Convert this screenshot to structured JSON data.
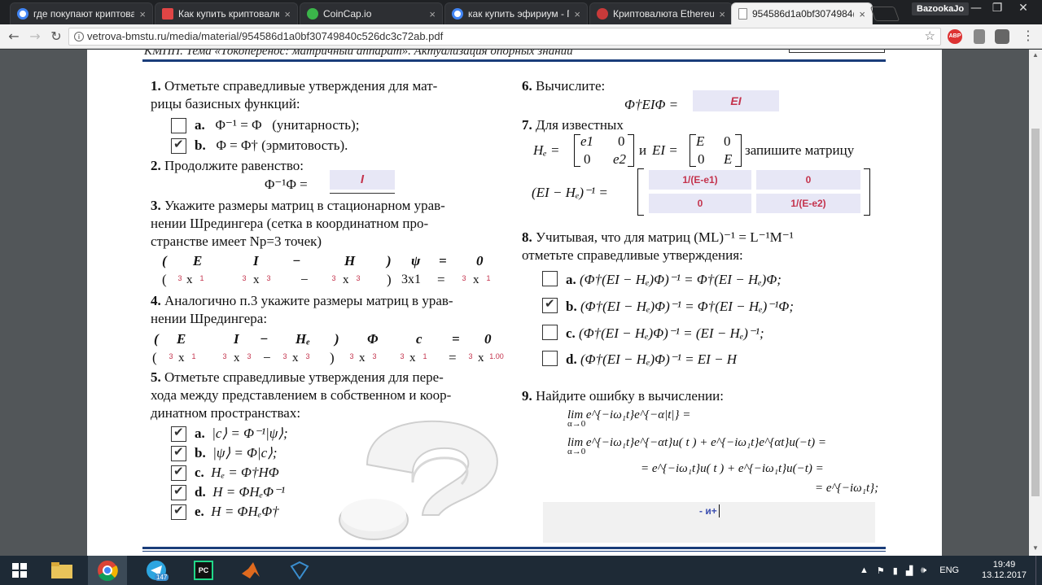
{
  "browser": {
    "tabs": [
      {
        "title": "где покупают криптова",
        "favicon": "google",
        "color": "#4285f4"
      },
      {
        "title": "Как купить криптовалю",
        "favicon": "d",
        "color": "#e04545"
      },
      {
        "title": "CoinCap.io",
        "favicon": "coincap",
        "color": "#3bb54a"
      },
      {
        "title": "как купить эфириум - Г",
        "favicon": "google",
        "color": "#4285f4"
      },
      {
        "title": "Криптовалюта Ethereu",
        "favicon": "eth",
        "color": "#c83a3a"
      },
      {
        "title": "954586d1a0bf3074984(",
        "favicon": "doc",
        "color": "#888888"
      }
    ],
    "profile": "BazookaJo",
    "url": "vetrova-bmstu.ru/media/material/954586d1a0bf30749840c526dc3c72ab.pdf",
    "ext_abp": "ABP"
  },
  "doc": {
    "header": "КМПП. Тема «Токоперенос: матричный аппарат». Актуализация опорных знаний",
    "q1": {
      "num": "1.",
      "text1": "Отметьте справедливые утверждения для мат-",
      "text2": "рицы базисных функций:",
      "a": {
        "label": "a.",
        "expr": "Φ⁻¹ = Φ",
        "note": "(унитарность);",
        "checked": false
      },
      "b": {
        "label": "b.",
        "expr": "Φ    = Φ†",
        "note": "(эрмитовость).",
        "checked": true
      }
    },
    "q2": {
      "num": "2.",
      "text": "Продолжите равенство:",
      "expr": "Φ⁻¹Φ =",
      "answer": "I"
    },
    "q3": {
      "num": "3.",
      "line1": "Укажите размеры матриц в стационарном урав-",
      "line2": "нении Шредингера (сетка в координатном про-",
      "line3": "странстве имеет Np=3 точек)",
      "eq": [
        "(",
        "E",
        "I",
        "−",
        "H",
        ")",
        "ψ",
        "=",
        "0"
      ],
      "sizes": [
        "3",
        "1",
        "3",
        "3",
        "3",
        "3",
        "3",
        "1"
      ],
      "x": "x",
      "minus": "−",
      "paren_close": ")",
      "fixed": "3x1",
      "eq_sign": "="
    },
    "q4": {
      "num": "4.",
      "line1": "Аналогично п.3 укажите размеры матриц в урав-",
      "line2": "нении Шредингера:",
      "eq": [
        "(",
        "E",
        "I",
        "−",
        "Hₑ",
        ")",
        "Φ",
        "c",
        "=",
        "0"
      ],
      "sizes": [
        "3",
        "1",
        "3",
        "3",
        "3",
        "3",
        "3",
        "3",
        "3",
        "1",
        "3",
        "1.00"
      ]
    },
    "q5": {
      "num": "5.",
      "line1": "Отметьте справедливые утверждения для пере-",
      "line2": "хода между представлением в собственном и коор-",
      "line3": "динатном пространствах:",
      "items": [
        {
          "label": "a.",
          "expr": "|c⟩ = Φ⁻¹|ψ⟩;",
          "checked": true
        },
        {
          "label": "b.",
          "expr": "|ψ⟩ = Φ|c⟩;",
          "checked": true
        },
        {
          "label": "c.",
          "expr": "Hₑ = Φ†HΦ",
          "checked": true
        },
        {
          "label": "d.",
          "expr": "H = ΦHₑΦ⁻¹",
          "checked": true
        },
        {
          "label": "e.",
          "expr": "H = ΦHₑΦ†",
          "checked": true
        }
      ]
    },
    "q6": {
      "num": "6.",
      "text": "Вычислите:",
      "expr": "Φ†EIΦ =",
      "answer": "EI"
    },
    "q7": {
      "num": "7.",
      "text": "Для известных",
      "he": "Hₑ =",
      "m11": "e1",
      "m12": "0",
      "m21": "0",
      "m22": "e2",
      "and": "и",
      "ei": "EI =",
      "n11": "E",
      "n12": "0",
      "n21": "0",
      "n22": "E",
      "write": "запишите матрицу",
      "lhs": "(EI − Hₑ)⁻¹ =",
      "cells": [
        "1/(E-e1)",
        "0",
        "0",
        "1/(E-e2)"
      ]
    },
    "q8": {
      "num": "8.",
      "line1": "Учитывая, что для матриц (ML)⁻¹ = L⁻¹M⁻¹",
      "line2": "отметьте справедливые утверждения:",
      "items": [
        {
          "label": "a.",
          "expr": "(Φ†(EI − Hₑ)Φ)⁻¹ = Φ†(EI − Hₑ)Φ;",
          "checked": false
        },
        {
          "label": "b.",
          "expr": "(Φ†(EI − Hₑ)Φ)⁻¹ = Φ†(EI − Hₑ)⁻¹Φ;",
          "checked": true
        },
        {
          "label": "c.",
          "expr": "(Φ†(EI − Hₑ)Φ)⁻¹ = (EI − Hₑ)⁻¹;",
          "checked": false
        },
        {
          "label": "d.",
          "expr": "(Φ†(EI − Hₑ)Φ)⁻¹ = EI − H",
          "checked": false
        }
      ]
    },
    "q9": {
      "num": "9.",
      "text": "Найдите ошибку в вычислении:",
      "l1": "lim e^{−iω₁t}e^{−α|t|} =",
      "l1sub": "α→0",
      "l2": "lim e^{−iω₁t}e^{−αt}u( t ) + e^{−iω₁t}e^{αt}u(−t) =",
      "l2sub": "α→0",
      "l3": "= e^{−iω₁t}u( t ) + e^{−iω₁t}u(−t) =",
      "l4": "= e^{−iω₁t};",
      "answer": "- и+"
    }
  },
  "taskbar": {
    "lang": "ENG",
    "time": "19:49",
    "date": "13.12.2017",
    "telegram_badge": "147"
  }
}
